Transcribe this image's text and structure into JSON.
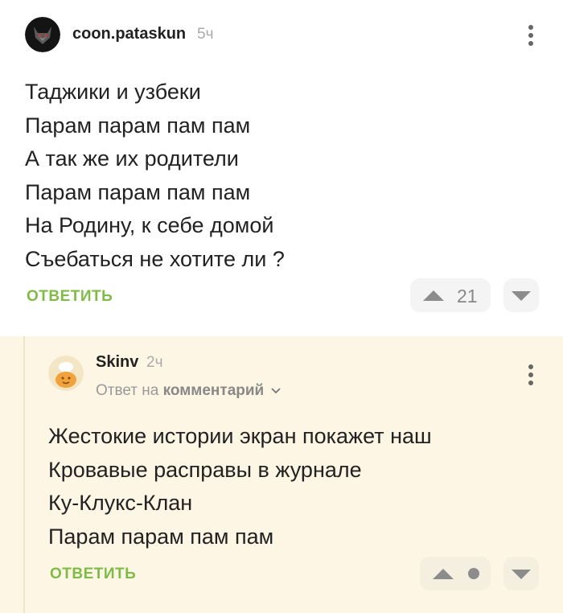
{
  "comment1": {
    "author": "coon.pataskun",
    "time": "5ч",
    "lines": [
      "Таджики и узбеки",
      "Парам парам пам пам",
      "А так же их родители",
      "Парам парам пам пам",
      "На Родину, к себе домой",
      "Съебаться не хотите ли ?"
    ],
    "reply_label": "ОТВЕТИТЬ",
    "score": "21"
  },
  "comment2": {
    "author": "Skinv",
    "time": "2ч",
    "reply_to_prefix": "Ответ на",
    "reply_to_link": "комментарий",
    "lines": [
      "Жестокие истории экран покажет наш",
      "Кровавые расправы в журнале",
      "Ку-Клукс-Клан",
      "Парам парам пам пам"
    ],
    "reply_label": "ОТВЕТИТЬ"
  },
  "colors": {
    "accent_green": "#7fbb47",
    "reply_background": "#fdf6e4"
  },
  "icons": [
    "wolf-avatar",
    "chef-avatar",
    "more-vertical-icon",
    "upvote-icon",
    "downvote-icon",
    "chevron-down-icon",
    "score-hidden-dot"
  ]
}
